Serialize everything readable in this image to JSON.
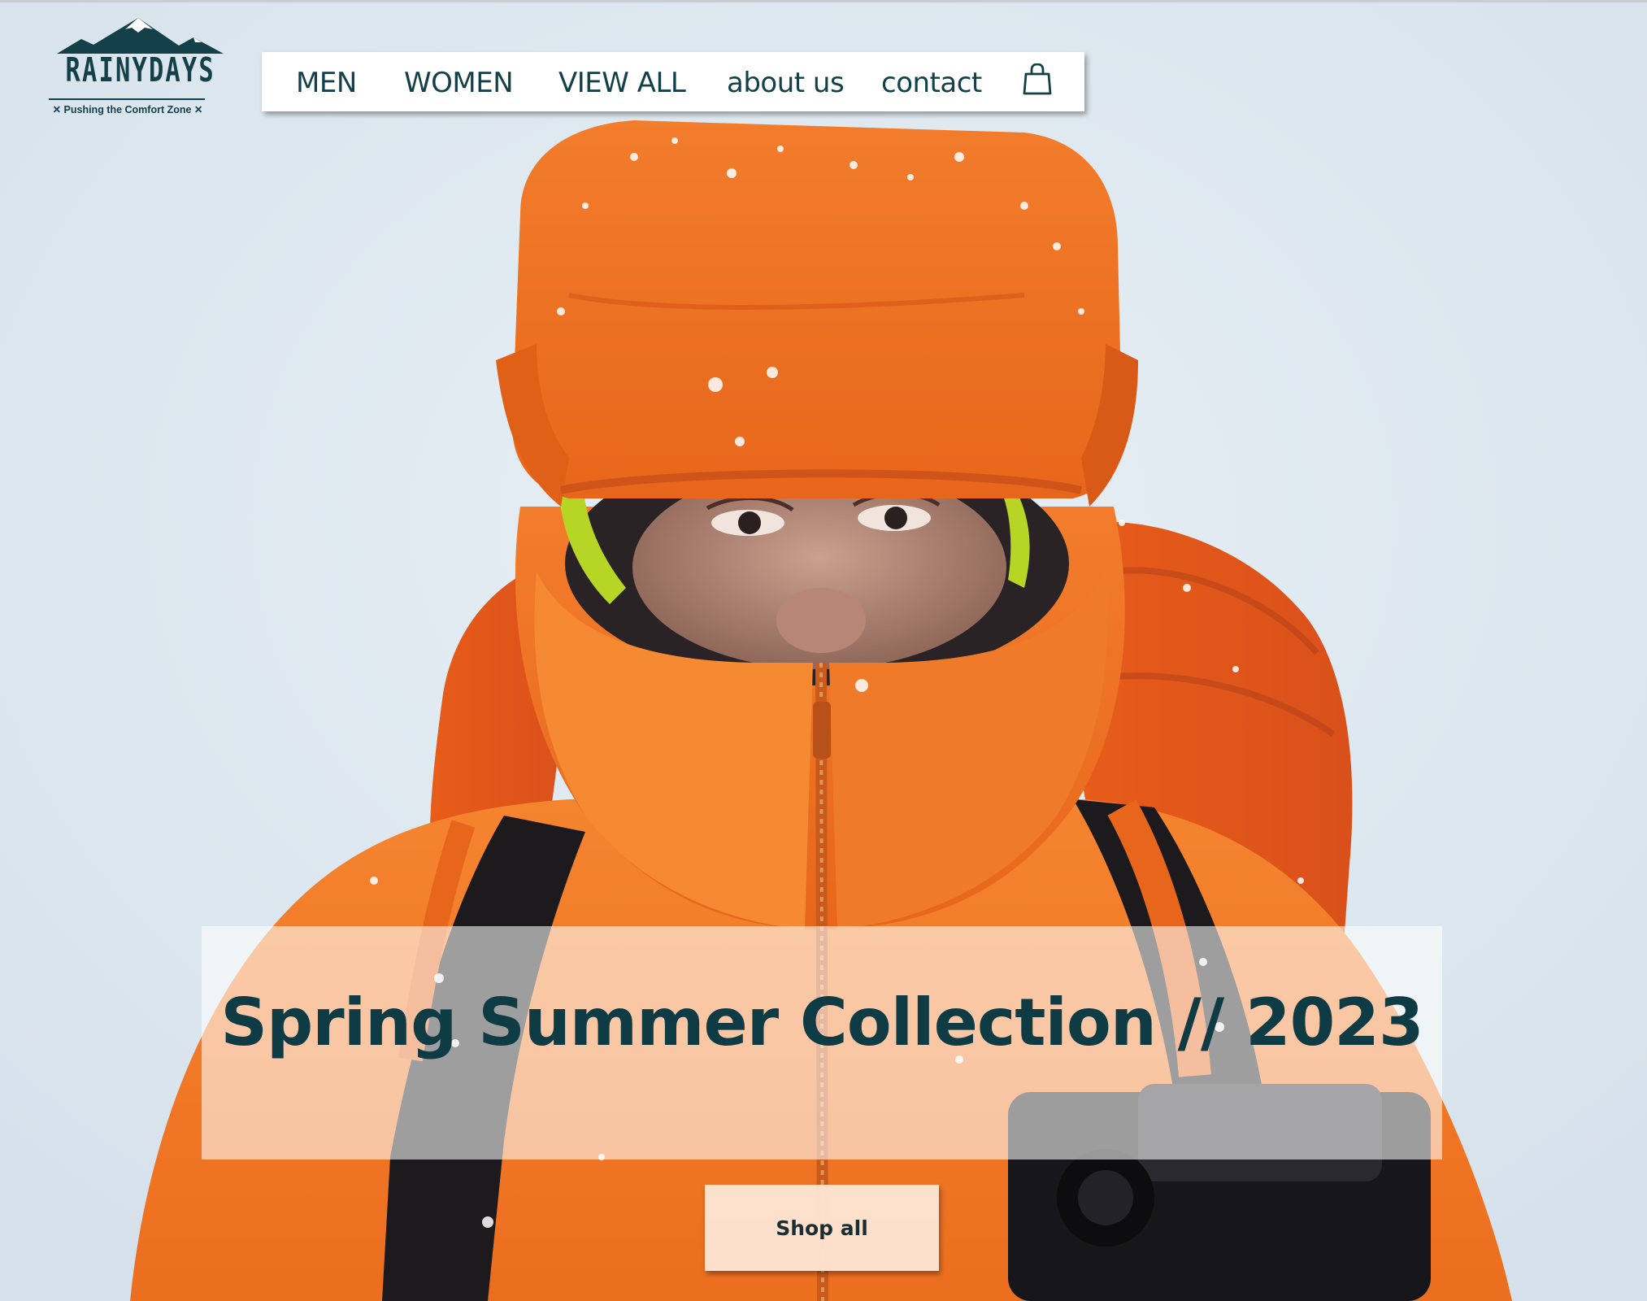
{
  "brand": {
    "name": "RAINYDAYS",
    "tagline": "✕ Pushing the Comfort Zone ✕"
  },
  "nav": {
    "items": [
      {
        "label": "MEN"
      },
      {
        "label": "WOMEN"
      },
      {
        "label": "VIEW ALL"
      },
      {
        "label": "about us"
      },
      {
        "label": "contact"
      }
    ],
    "cart_icon": "shopping-bag-icon"
  },
  "hero": {
    "image_subject": "hiker-in-orange-jacket",
    "title": "Spring Summer Collection // 2023",
    "cta_label": "Shop all"
  },
  "colors": {
    "brand_dark": "#14404a",
    "jacket_orange": "#f07a26",
    "sky": "#dfe9f0",
    "cta_bg": "#fde4d2"
  }
}
